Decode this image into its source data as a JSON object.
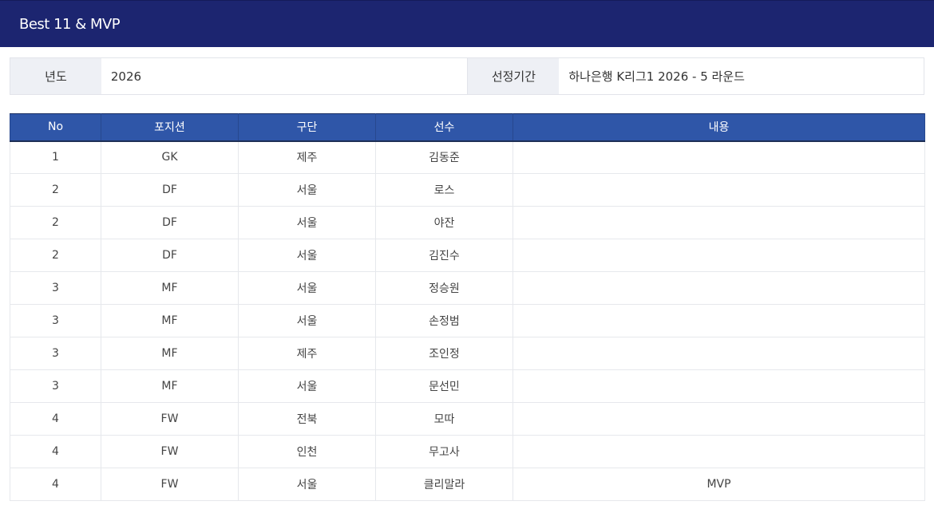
{
  "title": "Best 11 & MVP",
  "info": {
    "year_label": "년도",
    "year_value": "2026",
    "period_label": "선정기간",
    "period_value": "하나은행 K리그1 2026 - 5 라운드"
  },
  "table": {
    "headers": [
      "No",
      "포지션",
      "구단",
      "선수",
      "내용"
    ],
    "rows": [
      [
        "1",
        "GK",
        "제주",
        "김동준",
        ""
      ],
      [
        "2",
        "DF",
        "서울",
        "로스",
        ""
      ],
      [
        "2",
        "DF",
        "서울",
        "야잔",
        ""
      ],
      [
        "2",
        "DF",
        "서울",
        "김진수",
        ""
      ],
      [
        "3",
        "MF",
        "서울",
        "정승원",
        ""
      ],
      [
        "3",
        "MF",
        "서울",
        "손정범",
        ""
      ],
      [
        "3",
        "MF",
        "제주",
        "조인정",
        ""
      ],
      [
        "3",
        "MF",
        "서울",
        "문선민",
        ""
      ],
      [
        "4",
        "FW",
        "전북",
        "모따",
        ""
      ],
      [
        "4",
        "FW",
        "인천",
        "무고사",
        ""
      ],
      [
        "4",
        "FW",
        "서울",
        "클리말라",
        "MVP"
      ]
    ]
  }
}
